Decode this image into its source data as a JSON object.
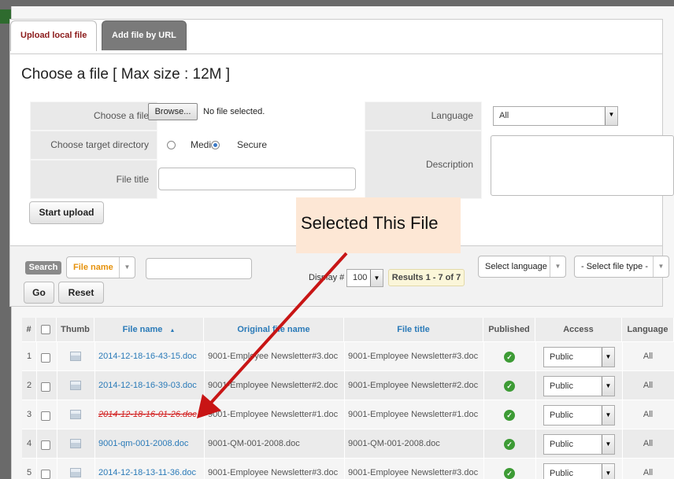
{
  "tabs": [
    {
      "label": "Upload local file",
      "active": true
    },
    {
      "label": "Add file by URL",
      "active": false
    }
  ],
  "upload": {
    "title": "Choose a file [ Max size : 12M ]",
    "choose_file_label": "Choose a file",
    "browse_label": "Browse...",
    "no_file_text": "No file selected.",
    "target_dir_label": "Choose target directory",
    "dir_options": [
      {
        "label": "Media",
        "checked": false
      },
      {
        "label": "Secure",
        "checked": true
      }
    ],
    "media_visible_text": "Medi",
    "file_title_label": "File title",
    "file_title_value": "",
    "language_label": "Language",
    "language_value": "All",
    "description_label": "Description",
    "description_value": "",
    "start_upload_label": "Start upload"
  },
  "search": {
    "tag": "Search",
    "field_value": "File name",
    "query_value": "",
    "display_label": "Display #",
    "display_value": "100",
    "results_text": "Results 1 - 7 of 7",
    "select_language": "Select language",
    "select_file_type": "- Select file type -",
    "go_label": "Go",
    "reset_label": "Reset"
  },
  "table": {
    "headers": [
      "#",
      "",
      "Thumb",
      "File name",
      "Original file name",
      "File title",
      "Published",
      "Access",
      "Language"
    ],
    "sort_indicator": "▲",
    "rows": [
      {
        "num": "1",
        "file_name": "2014-12-18-16-43-15.doc",
        "original": "9001-Employee Newsletter#3.doc",
        "title": "9001-Employee Newsletter#3.doc",
        "published": true,
        "access": "Public",
        "language": "All",
        "selected": false
      },
      {
        "num": "2",
        "file_name": "2014-12-18-16-39-03.doc",
        "original": "9001-Employee Newsletter#2.doc",
        "title": "9001-Employee Newsletter#2.doc",
        "published": true,
        "access": "Public",
        "language": "All",
        "selected": false
      },
      {
        "num": "3",
        "file_name": "2014-12-18-16-01-26.doc",
        "original": "9001-Employee Newsletter#1.doc",
        "title": "9001-Employee Newsletter#1.doc",
        "published": true,
        "access": "Public",
        "language": "All",
        "selected": true
      },
      {
        "num": "4",
        "file_name": "9001-qm-001-2008.doc",
        "original": "9001-QM-001-2008.doc",
        "title": "9001-QM-001-2008.doc",
        "published": true,
        "access": "Public",
        "language": "All",
        "selected": false
      },
      {
        "num": "5",
        "file_name": "2014-12-18-13-11-36.doc",
        "original": "9001-Employee Newsletter#3.doc",
        "title": "9001-Employee Newsletter#3.doc",
        "published": true,
        "access": "Public",
        "language": "All",
        "selected": false
      }
    ]
  },
  "callout": {
    "text": "Selected This File"
  },
  "colors": {
    "accent_tab": "#8b1a1a",
    "link": "#2a7ab8",
    "arrow": "#c81515",
    "callout_bg": "#fde7d5",
    "published": "#3d9b35"
  }
}
